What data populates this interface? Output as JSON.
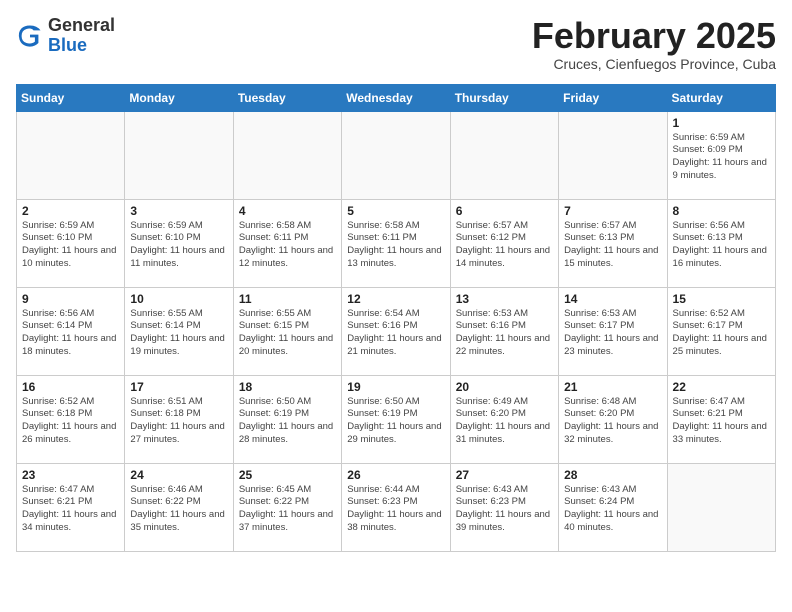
{
  "header": {
    "logo_general": "General",
    "logo_blue": "Blue",
    "title": "February 2025",
    "subtitle": "Cruces, Cienfuegos Province, Cuba"
  },
  "days_of_week": [
    "Sunday",
    "Monday",
    "Tuesday",
    "Wednesday",
    "Thursday",
    "Friday",
    "Saturday"
  ],
  "weeks": [
    [
      {
        "day": "",
        "info": ""
      },
      {
        "day": "",
        "info": ""
      },
      {
        "day": "",
        "info": ""
      },
      {
        "day": "",
        "info": ""
      },
      {
        "day": "",
        "info": ""
      },
      {
        "day": "",
        "info": ""
      },
      {
        "day": "1",
        "info": "Sunrise: 6:59 AM\nSunset: 6:09 PM\nDaylight: 11 hours and 9 minutes."
      }
    ],
    [
      {
        "day": "2",
        "info": "Sunrise: 6:59 AM\nSunset: 6:10 PM\nDaylight: 11 hours and 10 minutes."
      },
      {
        "day": "3",
        "info": "Sunrise: 6:59 AM\nSunset: 6:10 PM\nDaylight: 11 hours and 11 minutes."
      },
      {
        "day": "4",
        "info": "Sunrise: 6:58 AM\nSunset: 6:11 PM\nDaylight: 11 hours and 12 minutes."
      },
      {
        "day": "5",
        "info": "Sunrise: 6:58 AM\nSunset: 6:11 PM\nDaylight: 11 hours and 13 minutes."
      },
      {
        "day": "6",
        "info": "Sunrise: 6:57 AM\nSunset: 6:12 PM\nDaylight: 11 hours and 14 minutes."
      },
      {
        "day": "7",
        "info": "Sunrise: 6:57 AM\nSunset: 6:13 PM\nDaylight: 11 hours and 15 minutes."
      },
      {
        "day": "8",
        "info": "Sunrise: 6:56 AM\nSunset: 6:13 PM\nDaylight: 11 hours and 16 minutes."
      }
    ],
    [
      {
        "day": "9",
        "info": "Sunrise: 6:56 AM\nSunset: 6:14 PM\nDaylight: 11 hours and 18 minutes."
      },
      {
        "day": "10",
        "info": "Sunrise: 6:55 AM\nSunset: 6:14 PM\nDaylight: 11 hours and 19 minutes."
      },
      {
        "day": "11",
        "info": "Sunrise: 6:55 AM\nSunset: 6:15 PM\nDaylight: 11 hours and 20 minutes."
      },
      {
        "day": "12",
        "info": "Sunrise: 6:54 AM\nSunset: 6:16 PM\nDaylight: 11 hours and 21 minutes."
      },
      {
        "day": "13",
        "info": "Sunrise: 6:53 AM\nSunset: 6:16 PM\nDaylight: 11 hours and 22 minutes."
      },
      {
        "day": "14",
        "info": "Sunrise: 6:53 AM\nSunset: 6:17 PM\nDaylight: 11 hours and 23 minutes."
      },
      {
        "day": "15",
        "info": "Sunrise: 6:52 AM\nSunset: 6:17 PM\nDaylight: 11 hours and 25 minutes."
      }
    ],
    [
      {
        "day": "16",
        "info": "Sunrise: 6:52 AM\nSunset: 6:18 PM\nDaylight: 11 hours and 26 minutes."
      },
      {
        "day": "17",
        "info": "Sunrise: 6:51 AM\nSunset: 6:18 PM\nDaylight: 11 hours and 27 minutes."
      },
      {
        "day": "18",
        "info": "Sunrise: 6:50 AM\nSunset: 6:19 PM\nDaylight: 11 hours and 28 minutes."
      },
      {
        "day": "19",
        "info": "Sunrise: 6:50 AM\nSunset: 6:19 PM\nDaylight: 11 hours and 29 minutes."
      },
      {
        "day": "20",
        "info": "Sunrise: 6:49 AM\nSunset: 6:20 PM\nDaylight: 11 hours and 31 minutes."
      },
      {
        "day": "21",
        "info": "Sunrise: 6:48 AM\nSunset: 6:20 PM\nDaylight: 11 hours and 32 minutes."
      },
      {
        "day": "22",
        "info": "Sunrise: 6:47 AM\nSunset: 6:21 PM\nDaylight: 11 hours and 33 minutes."
      }
    ],
    [
      {
        "day": "23",
        "info": "Sunrise: 6:47 AM\nSunset: 6:21 PM\nDaylight: 11 hours and 34 minutes."
      },
      {
        "day": "24",
        "info": "Sunrise: 6:46 AM\nSunset: 6:22 PM\nDaylight: 11 hours and 35 minutes."
      },
      {
        "day": "25",
        "info": "Sunrise: 6:45 AM\nSunset: 6:22 PM\nDaylight: 11 hours and 37 minutes."
      },
      {
        "day": "26",
        "info": "Sunrise: 6:44 AM\nSunset: 6:23 PM\nDaylight: 11 hours and 38 minutes."
      },
      {
        "day": "27",
        "info": "Sunrise: 6:43 AM\nSunset: 6:23 PM\nDaylight: 11 hours and 39 minutes."
      },
      {
        "day": "28",
        "info": "Sunrise: 6:43 AM\nSunset: 6:24 PM\nDaylight: 11 hours and 40 minutes."
      },
      {
        "day": "",
        "info": ""
      }
    ]
  ]
}
